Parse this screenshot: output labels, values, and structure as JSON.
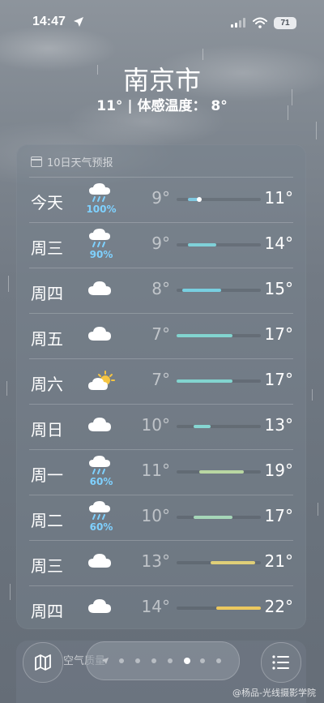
{
  "status": {
    "time": "14:47",
    "battery": "71"
  },
  "header": {
    "city": "南京市",
    "summary": "11° | 体感温度： 8°"
  },
  "forecast": {
    "title": "10日天气预报",
    "temp_range": [
      7,
      22
    ],
    "days": [
      {
        "day": "今天",
        "icon": "rain-icon",
        "precip": "100%",
        "low": "9°",
        "high": "11°",
        "low_value": 9,
        "high_value": 11,
        "current_value": 11,
        "bar_color": "#7fc8e0"
      },
      {
        "day": "周三",
        "icon": "rain-icon",
        "precip": "90%",
        "low": "9°",
        "high": "14°",
        "low_value": 9,
        "high_value": 14,
        "bar_color": "#7fd0d8"
      },
      {
        "day": "周四",
        "icon": "cloud-icon",
        "precip": "",
        "low": "8°",
        "high": "15°",
        "low_value": 8,
        "high_value": 15,
        "bar_color": "#78cfe0"
      },
      {
        "day": "周五",
        "icon": "cloud-icon",
        "precip": "",
        "low": "7°",
        "high": "17°",
        "low_value": 7,
        "high_value": 17,
        "bar_color": "#82d4cf"
      },
      {
        "day": "周六",
        "icon": "partly-sunny-icon",
        "precip": "",
        "low": "7°",
        "high": "17°",
        "low_value": 7,
        "high_value": 17,
        "bar_color": "#82d4cf"
      },
      {
        "day": "周日",
        "icon": "cloud-icon",
        "precip": "",
        "low": "10°",
        "high": "13°",
        "low_value": 10,
        "high_value": 13,
        "bar_color": "#86d6d2"
      },
      {
        "day": "周一",
        "icon": "rain-icon",
        "precip": "60%",
        "low": "11°",
        "high": "19°",
        "low_value": 11,
        "high_value": 19,
        "bar_color": "#b9d7a2"
      },
      {
        "day": "周二",
        "icon": "rain-icon",
        "precip": "60%",
        "low": "10°",
        "high": "17°",
        "low_value": 10,
        "high_value": 17,
        "bar_color": "#a6d6b8"
      },
      {
        "day": "周三",
        "icon": "cloud-icon",
        "precip": "",
        "low": "13°",
        "high": "21°",
        "low_value": 13,
        "high_value": 21,
        "bar_color": "#e0cf78"
      },
      {
        "day": "周四",
        "icon": "cloud-icon",
        "precip": "",
        "low": "14°",
        "high": "22°",
        "low_value": 14,
        "high_value": 22,
        "bar_color": "#ecc85e"
      }
    ]
  },
  "bottom": {
    "air_label": "空气质量",
    "page_count": 7,
    "active_page": 5,
    "watermark": "@杨品-光线摄影学院"
  }
}
